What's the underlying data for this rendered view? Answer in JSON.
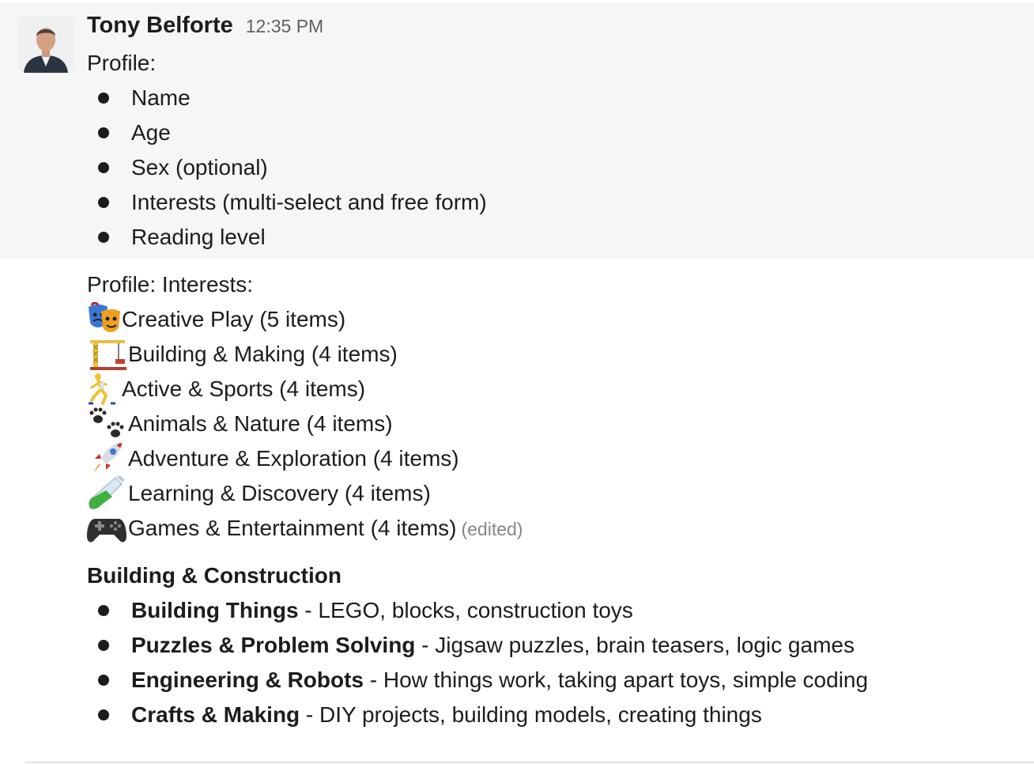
{
  "message": {
    "sender": "Tony Belforte",
    "timestamp": "12:35 PM",
    "intro": "Profile:",
    "profile_fields": [
      "Name",
      "Age",
      "Sex (optional)",
      "Interests (multi-select and free form)",
      "Reading level"
    ]
  },
  "continuation": {
    "heading": "Profile: Interests:",
    "interests": [
      {
        "icon": "performing-arts-icon",
        "label": "Creative Play (5 items)"
      },
      {
        "icon": "construction-crane-icon",
        "label": "Building & Making (4 items)"
      },
      {
        "icon": "runner-icon",
        "label": "Active & Sports (4 items)"
      },
      {
        "icon": "paw-prints-icon",
        "label": "Animals & Nature (4 items)"
      },
      {
        "icon": "rocket-icon",
        "label": "Adventure & Exploration (4 items)"
      },
      {
        "icon": "test-tube-icon",
        "label": "Learning & Discovery (4 items)"
      },
      {
        "icon": "game-controller-icon",
        "label": "Games & Entertainment (4 items)"
      }
    ],
    "edited_label": "(edited)",
    "section_title": "Building & Construction",
    "section_items": [
      {
        "bold": "Building Things",
        "rest": " - LEGO, blocks, construction toys"
      },
      {
        "bold": "Puzzles & Problem Solving",
        "rest": " - Jigsaw puzzles, brain teasers, logic games"
      },
      {
        "bold": "Engineering & Robots",
        "rest": " - How things work, taking apart toys, simple coding"
      },
      {
        "bold": "Crafts & Making",
        "rest": " - DIY projects, building models, creating things"
      }
    ]
  },
  "colors": {
    "text": "#1d1c1d",
    "timestamp": "#616061",
    "hover_background": "#f6f6f6",
    "edited": "#868686"
  }
}
